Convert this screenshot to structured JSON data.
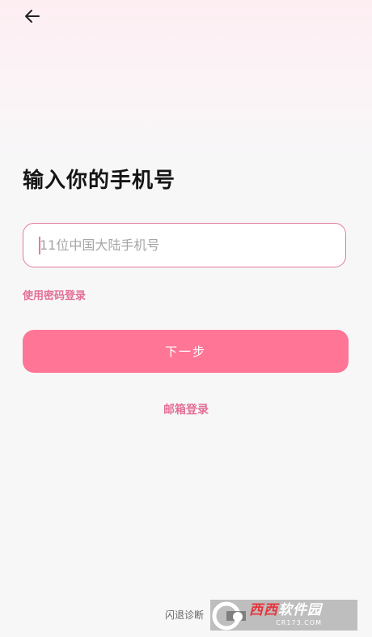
{
  "nav": {
    "back_icon": "arrow-left-icon"
  },
  "title": "输入你的手机号",
  "phone": {
    "value": "",
    "placeholder": "11位中国大陆手机号"
  },
  "links": {
    "password_login": "使用密码登录",
    "email_login": "邮箱登录",
    "crash_diagnosis": "闪退诊断"
  },
  "buttons": {
    "next": "下一步"
  },
  "watermark": {
    "brand_red": "西西",
    "brand_rest": "软件园",
    "domain": "CR173.COM"
  },
  "colors": {
    "accent": "#ff7596",
    "link": "#e46f95",
    "input_border": "#e27b9e",
    "background": "#f7f7f7"
  }
}
